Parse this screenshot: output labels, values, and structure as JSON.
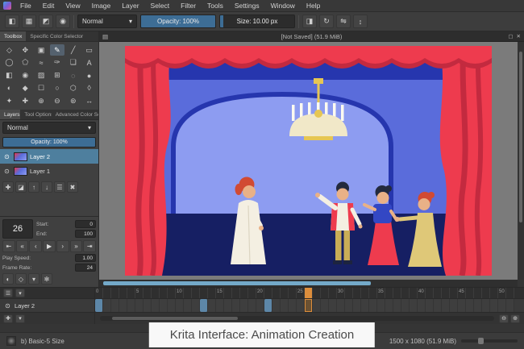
{
  "icons": {
    "chevron": "▾",
    "eye": "⊙",
    "close": "✕",
    "restore": "▢",
    "doc": "▤"
  },
  "menu_bar": {
    "items": [
      "File",
      "Edit",
      "View",
      "Image",
      "Layer",
      "Select",
      "Filter",
      "Tools",
      "Settings",
      "Window",
      "Help"
    ]
  },
  "toolbar": {
    "left_icons": [
      {
        "name": "gradient-chooser-icon",
        "glyph": "◧"
      },
      {
        "name": "pattern-chooser-icon",
        "glyph": "▦"
      },
      {
        "name": "fg-bg-color-icon",
        "glyph": "◩"
      },
      {
        "name": "brush-preset-chooser-icon",
        "glyph": "◉"
      }
    ],
    "blend_mode": "Normal",
    "opacity_label": "Opacity: 100%",
    "opacity_pct": 100,
    "size_label": "Size: 10.00 px",
    "size_pct": 4,
    "right_icons": [
      {
        "name": "eraser-mode-icon",
        "glyph": "◨"
      },
      {
        "name": "reload-preset-icon",
        "glyph": "↻"
      },
      {
        "name": "mirror-horizontal-icon",
        "glyph": "⇋"
      },
      {
        "name": "mirror-vertical-icon",
        "glyph": "↕"
      }
    ]
  },
  "subwindow": {
    "title": "[Not Saved] (51.9 MiB)"
  },
  "left_dock": {
    "top_tabs": [
      "Toolbox",
      "Specific Color Selector"
    ],
    "tools": [
      {
        "name": "transform-tool",
        "glyph": "◇"
      },
      {
        "name": "move-tool",
        "glyph": "✥"
      },
      {
        "name": "crop-tool",
        "glyph": "▣"
      },
      {
        "name": "freehand-brush-tool",
        "glyph": "✎",
        "selected": true
      },
      {
        "name": "line-tool",
        "glyph": "╱"
      },
      {
        "name": "rectangle-tool",
        "glyph": "▭"
      },
      {
        "name": "ellipse-tool",
        "glyph": "◯"
      },
      {
        "name": "polygon-tool",
        "glyph": "⬠"
      },
      {
        "name": "polyline-tool",
        "glyph": "≈"
      },
      {
        "name": "calligraphy-tool",
        "glyph": "✑"
      },
      {
        "name": "dynamic-brush-tool",
        "glyph": "❏"
      },
      {
        "name": "text-tool",
        "glyph": "A"
      },
      {
        "name": "gradient-tool",
        "glyph": "◧"
      },
      {
        "name": "color-sampler-tool",
        "glyph": "◉"
      },
      {
        "name": "pattern-edit-tool",
        "glyph": "▨"
      },
      {
        "name": "assistants-tool",
        "glyph": "⊞"
      },
      {
        "name": "smart-patch-tool",
        "glyph": "◌"
      },
      {
        "name": "fill-tool",
        "glyph": "●"
      },
      {
        "name": "colorize-mask-tool",
        "glyph": "◐"
      },
      {
        "name": "reference-images-tool",
        "glyph": "◆"
      },
      {
        "name": "rectangular-selection-tool",
        "glyph": "☐"
      },
      {
        "name": "elliptical-selection-tool",
        "glyph": "○"
      },
      {
        "name": "polygonal-selection-tool",
        "glyph": "⬡"
      },
      {
        "name": "freehand-selection-tool",
        "glyph": "◊"
      },
      {
        "name": "contiguous-selection-tool",
        "glyph": "✦"
      },
      {
        "name": "similar-color-selection-tool",
        "glyph": "✚"
      },
      {
        "name": "bezier-selection-tool",
        "glyph": "⊕"
      },
      {
        "name": "magnetic-selection-tool",
        "glyph": "⊖"
      },
      {
        "name": "zoom-tool",
        "glyph": "⊛"
      },
      {
        "name": "pan-tool",
        "glyph": "↔"
      }
    ],
    "docker_tabs": [
      "Layers",
      "Tool Options",
      "Advanced Color Se..."
    ],
    "layers": {
      "blend_mode": "Normal",
      "opacity_label": "Opacity: 100%",
      "opacity_pct": 100,
      "rows": [
        {
          "name": "Layer 2",
          "selected": true
        },
        {
          "name": "Layer 1",
          "selected": false
        }
      ],
      "buttons": [
        {
          "name": "add-layer-button",
          "glyph": "✚"
        },
        {
          "name": "duplicate-layer-button",
          "glyph": "◪"
        },
        {
          "name": "move-layer-up-button",
          "glyph": "↑"
        },
        {
          "name": "move-layer-down-button",
          "glyph": "↓"
        },
        {
          "name": "layer-properties-button",
          "glyph": "☰"
        },
        {
          "name": "delete-layer-button",
          "glyph": "✖"
        }
      ]
    },
    "animation": {
      "current_frame": "26",
      "start_label": "Start:",
      "start_value": "0",
      "end_label": "End:",
      "end_value": "100",
      "playback": [
        {
          "name": "first-frame-button",
          "glyph": "⇤"
        },
        {
          "name": "previous-keyframe-button",
          "glyph": "«"
        },
        {
          "name": "previous-frame-button",
          "glyph": "‹"
        },
        {
          "name": "play-button",
          "glyph": "▶"
        },
        {
          "name": "next-frame-button",
          "glyph": "›"
        },
        {
          "name": "next-keyframe-button",
          "glyph": "»"
        },
        {
          "name": "last-frame-button",
          "glyph": "⇥"
        }
      ],
      "play_speed_label": "Play Speed:",
      "play_speed_value": "1.00",
      "frame_rate_label": "Frame Rate:",
      "frame_rate_value": "24",
      "extra_buttons": [
        {
          "name": "onion-skin-button",
          "glyph": "◐"
        },
        {
          "name": "auto-key-button",
          "glyph": "◇"
        },
        {
          "name": "drop-frames-button",
          "glyph": "▾"
        },
        {
          "name": "animation-settings-button",
          "glyph": "✻"
        }
      ]
    }
  },
  "timeline": {
    "layer_name": "Layer 2",
    "frames_visible": 52,
    "label_every": 5,
    "current_frame": 26,
    "keyframes": [
      0,
      13,
      21
    ],
    "controls_left": [
      {
        "name": "timeline-menu-button",
        "glyph": "☰"
      },
      {
        "name": "timeline-options-button",
        "glyph": "▾"
      }
    ],
    "controls_bottom": [
      {
        "name": "add-keyframe-button",
        "glyph": "✚"
      },
      {
        "name": "keyframe-menu-button",
        "glyph": "▾"
      }
    ],
    "zoom_buttons": [
      {
        "name": "timeline-zoom-out-button",
        "glyph": "⊖"
      },
      {
        "name": "timeline-zoom-in-button",
        "glyph": "⊕"
      }
    ]
  },
  "status_bar": {
    "brush_name": "b) Basic-5 Size",
    "memory": "1500 x 1080 (51.9 MiB)"
  },
  "caption": {
    "text": "Krita Interface: Animation Creation"
  },
  "colors": {
    "ui_bg": "#3b3b3b",
    "panel": "#404040",
    "panel_dark": "#2e2e2e",
    "border": "#2a2a2a",
    "text": "#c8c8c8",
    "sel": "#4e7f9e",
    "slider_fill": "#3d6d95",
    "scroll_handle": "#73a9c9",
    "tl_cur": "#dd8e3c",
    "tl_key": "#5d87a8",
    "canvas_gray": "#7b7b7b",
    "caption_bg": "#f8f8f8",
    "caption_text": "#4a4a4a",
    "i_red": "#ee3b4e",
    "i_red_dark": "#c32a3f",
    "i_beam": "#2636ae",
    "i_wall": "#5a6cdb",
    "i_arch": "#8d9cf1",
    "i_floor": "#161f63",
    "i_gold": "#e6c653",
    "i_cream": "#f1e8c8",
    "i_white": "#f4efe2",
    "i_skin": "#e9b187",
    "i_hair_red": "#d14a33",
    "i_hair_dark": "#232a3e",
    "i_dress_yellow": "#dfc878",
    "i_pants": "#c9ad56",
    "i_top_blue": "#3347c4"
  }
}
